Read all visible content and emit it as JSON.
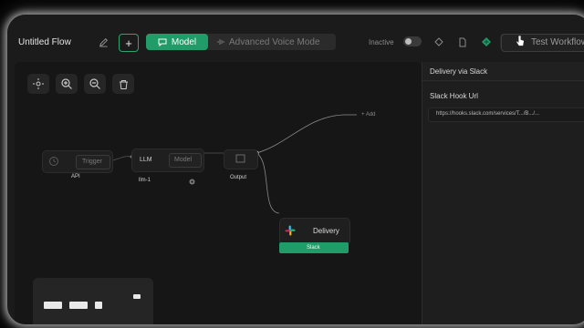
{
  "app": {
    "title": "Untitled Flow",
    "inactive_label": "Inactive",
    "accent_color": "#1f9c67"
  },
  "toolbar": {
    "edit_icon": "pencil-icon",
    "add_icon": "plus-icon",
    "add_label": "+",
    "mode_tabs": [
      {
        "label": "Model",
        "icon": "chat-icon",
        "active": true
      },
      {
        "label": "Advanced Voice Mode",
        "icon": "waveform-icon",
        "active": false
      }
    ],
    "status_toggle_on": false,
    "actions": [
      "code-icon",
      "document-icon",
      "slack-icon",
      "image-icon"
    ],
    "test_label": "Test Workflow"
  },
  "canvas": {
    "tools": [
      "recenter-icon",
      "zoom-in-icon",
      "zoom-out-icon",
      "delete-icon"
    ],
    "nodes": {
      "api": {
        "label": "API",
        "input_label": "Trigger"
      },
      "llm": {
        "title": "LLM",
        "subtitle": "llm-1",
        "input_label": "Model"
      },
      "output": {
        "label": "Output"
      },
      "delivery": {
        "label": "Delivery",
        "badge": "Slack"
      },
      "add": {
        "label": "+ Add"
      }
    }
  },
  "panel": {
    "title": "Delivery via Slack",
    "field_label": "Slack Hook Url",
    "field_value": "https://hooks.slack.com/services/T.../B.../..."
  }
}
